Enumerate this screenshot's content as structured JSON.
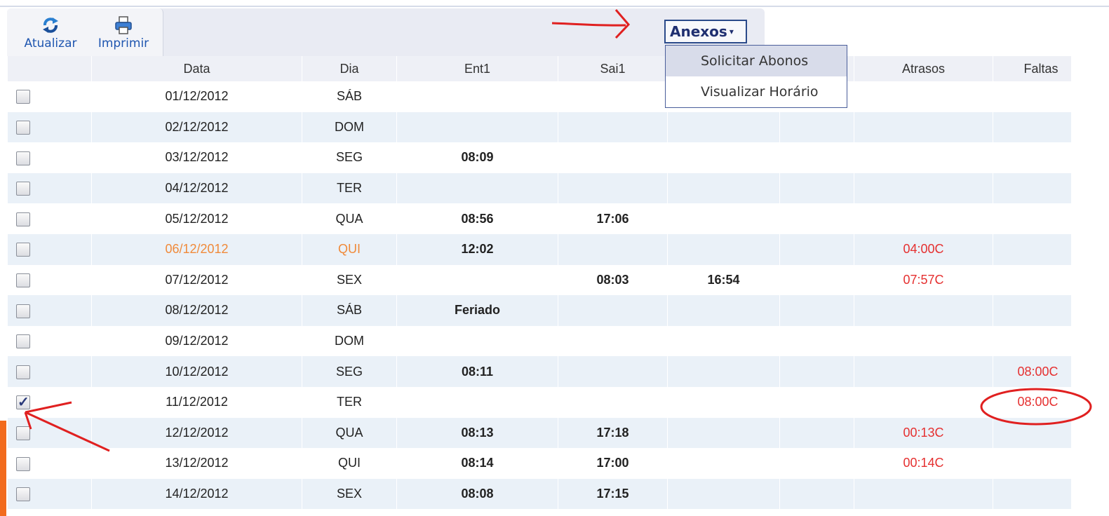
{
  "toolbar": {
    "refresh_label": "Atualizar",
    "print_label": "Imprimir",
    "refresh_icon": "refresh-icon",
    "print_icon": "printer-icon"
  },
  "anexos_menu": {
    "label": "Anexos",
    "items": [
      "Solicitar Abonos",
      "Visualizar Horário"
    ]
  },
  "table": {
    "headers": [
      "",
      "Data",
      "Dia",
      "Ent1",
      "Sai1",
      "",
      "",
      "Atrasos",
      "Faltas"
    ],
    "rows": [
      {
        "checked": false,
        "data": "01/12/2012",
        "dia": "SÁB",
        "ent1": "",
        "sai1": "",
        "c5": "",
        "c6": "",
        "atrasos": "",
        "faltas": ""
      },
      {
        "checked": false,
        "data": "02/12/2012",
        "dia": "DOM",
        "ent1": "",
        "sai1": "",
        "c5": "",
        "c6": "",
        "atrasos": "",
        "faltas": ""
      },
      {
        "checked": false,
        "data": "03/12/2012",
        "dia": "SEG",
        "ent1": "08:09",
        "sai1": "",
        "c5": "",
        "c6": "",
        "atrasos": "",
        "faltas": ""
      },
      {
        "checked": false,
        "data": "04/12/2012",
        "dia": "TER",
        "ent1": "",
        "sai1": "",
        "c5": "",
        "c6": "",
        "atrasos": "",
        "faltas": ""
      },
      {
        "checked": false,
        "data": "05/12/2012",
        "dia": "QUA",
        "ent1": "08:56",
        "sai1": "17:06",
        "c5": "",
        "c6": "",
        "atrasos": "",
        "faltas": ""
      },
      {
        "checked": false,
        "highlight": true,
        "data": "06/12/2012",
        "dia": "QUI",
        "ent1": "12:02",
        "sai1": "",
        "c5": "",
        "c6": "",
        "atrasos": "04:00C",
        "faltas": ""
      },
      {
        "checked": false,
        "data": "07/12/2012",
        "dia": "SEX",
        "ent1": "",
        "sai1": "08:03",
        "c5": "16:54",
        "c6": "",
        "atrasos": "07:57C",
        "faltas": ""
      },
      {
        "checked": false,
        "data": "08/12/2012",
        "dia": "SÁB",
        "ent1": "Feriado",
        "sai1": "",
        "c5": "",
        "c6": "",
        "atrasos": "",
        "faltas": ""
      },
      {
        "checked": false,
        "data": "09/12/2012",
        "dia": "DOM",
        "ent1": "",
        "sai1": "",
        "c5": "",
        "c6": "",
        "atrasos": "",
        "faltas": ""
      },
      {
        "checked": false,
        "data": "10/12/2012",
        "dia": "SEG",
        "ent1": "08:11",
        "sai1": "",
        "c5": "",
        "c6": "",
        "atrasos": "",
        "faltas": "08:00C"
      },
      {
        "checked": true,
        "data": "11/12/2012",
        "dia": "TER",
        "ent1": "",
        "sai1": "",
        "c5": "",
        "c6": "",
        "atrasos": "",
        "faltas": "08:00C"
      },
      {
        "checked": false,
        "data": "12/12/2012",
        "dia": "QUA",
        "ent1": "08:13",
        "sai1": "17:18",
        "c5": "",
        "c6": "",
        "atrasos": "00:13C",
        "faltas": ""
      },
      {
        "checked": false,
        "data": "13/12/2012",
        "dia": "QUI",
        "ent1": "08:14",
        "sai1": "17:00",
        "c5": "",
        "c6": "",
        "atrasos": "00:14C",
        "faltas": ""
      },
      {
        "checked": false,
        "data": "14/12/2012",
        "dia": "SEX",
        "ent1": "08:08",
        "sai1": "17:15",
        "c5": "",
        "c6": "",
        "atrasos": "",
        "faltas": ""
      }
    ]
  },
  "colors": {
    "highlight_text": "#f08a3a",
    "warning_text": "#e53030",
    "annotation": "#e02020",
    "row_stripe": "#eaf1f8",
    "accent_bar": "#f26b1d"
  }
}
